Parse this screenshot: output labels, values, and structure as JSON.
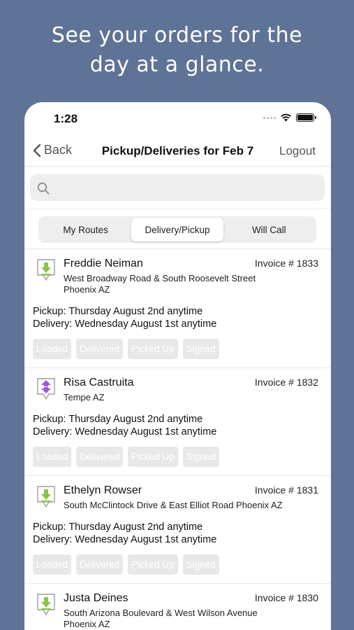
{
  "headline": {
    "line1": "See your orders for the",
    "line2": "day at a glance."
  },
  "status": {
    "time": "1:28"
  },
  "nav": {
    "back": "Back",
    "title": "Pickup/Deliveries for Feb 7",
    "logout": "Logout"
  },
  "search": {
    "placeholder": "",
    "value": ""
  },
  "segments": [
    {
      "label": "My Routes",
      "active": false
    },
    {
      "label": "Delivery/Pickup",
      "active": true
    },
    {
      "label": "Will Call",
      "active": false
    }
  ],
  "orders": [
    {
      "icon": "download-arrow-icon",
      "name": "Freddie Neiman",
      "invoice": "Invoice # 1833",
      "address": "West Broadway Road & South Roosevelt Street Phoenix AZ",
      "pickup": "Pickup: Thursday August 2nd anytime",
      "delivery": "Delivery: Wednesday August 1st anytime",
      "tags": [
        "Loaded",
        "Delivered",
        "Picked Up",
        "Signed"
      ]
    },
    {
      "icon": "up-down-arrow-icon",
      "name": "Risa Castruita",
      "invoice": "Invoice # 1832",
      "address": "Tempe AZ",
      "pickup": "Pickup: Thursday August 2nd anytime",
      "delivery": "Delivery: Wednesday August 1st anytime",
      "tags": [
        "Loaded",
        "Delivered",
        "Picked Up",
        "Signed"
      ]
    },
    {
      "icon": "download-arrow-icon",
      "name": "Ethelyn Rowser",
      "invoice": "Invoice # 1831",
      "address": "South McClintock Drive & East Elliot Road Phoenix AZ",
      "pickup": "Pickup: Thursday August 2nd anytime",
      "delivery": "Delivery: Wednesday August 1st anytime",
      "tags": [
        "Loaded",
        "Delivered",
        "Picked Up",
        "Signed"
      ]
    },
    {
      "icon": "download-arrow-icon",
      "name": "Justa Deines",
      "invoice": "Invoice # 1830",
      "address": "South Arizona Boulevard & West Wilson Avenue Phoenix AZ",
      "pickup": "",
      "delivery": "",
      "tags": []
    }
  ],
  "colors": {
    "background": "#5f7396",
    "delivery_icon": "#8bc34a",
    "both_icon": "#a259d9",
    "tag_disabled": "#e8e8e8"
  }
}
